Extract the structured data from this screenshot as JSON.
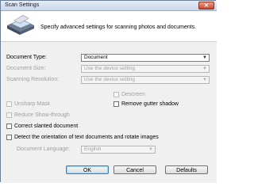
{
  "window": {
    "title": "Scan Settings",
    "close_glyph": "✕"
  },
  "header": {
    "description": "Specify advanced settings for scanning photos and documents."
  },
  "fields": {
    "document_type": {
      "label": "Document Type:",
      "value": "Document"
    },
    "document_size": {
      "label": "Document Size:",
      "value": "Use the device setting"
    },
    "scanning_resolution": {
      "label": "Scanning Resolution:",
      "value": "Use the device setting"
    },
    "document_language": {
      "label": "Document Language:",
      "value": "English"
    }
  },
  "checkboxes": {
    "descreen": {
      "label": "Descreen",
      "checked": false,
      "enabled": false
    },
    "unsharp_mask": {
      "label": "Unsharp Mask",
      "checked": false,
      "enabled": false
    },
    "remove_gutter_shadow": {
      "label": "Remove gutter shadow",
      "checked": false,
      "enabled": true
    },
    "reduce_show_through": {
      "label": "Reduce Show-through",
      "checked": false,
      "enabled": false
    },
    "correct_slanted": {
      "label": "Correct slanted document",
      "checked": false,
      "enabled": true
    },
    "detect_orientation": {
      "label": "Detect the orientation of text documents and rotate images",
      "checked": false,
      "enabled": true
    }
  },
  "buttons": {
    "ok": "OK",
    "cancel": "Cancel",
    "defaults": "Defaults"
  },
  "icons": {
    "dropdown_arrow": "▼",
    "scanner": "scanner-icon"
  }
}
